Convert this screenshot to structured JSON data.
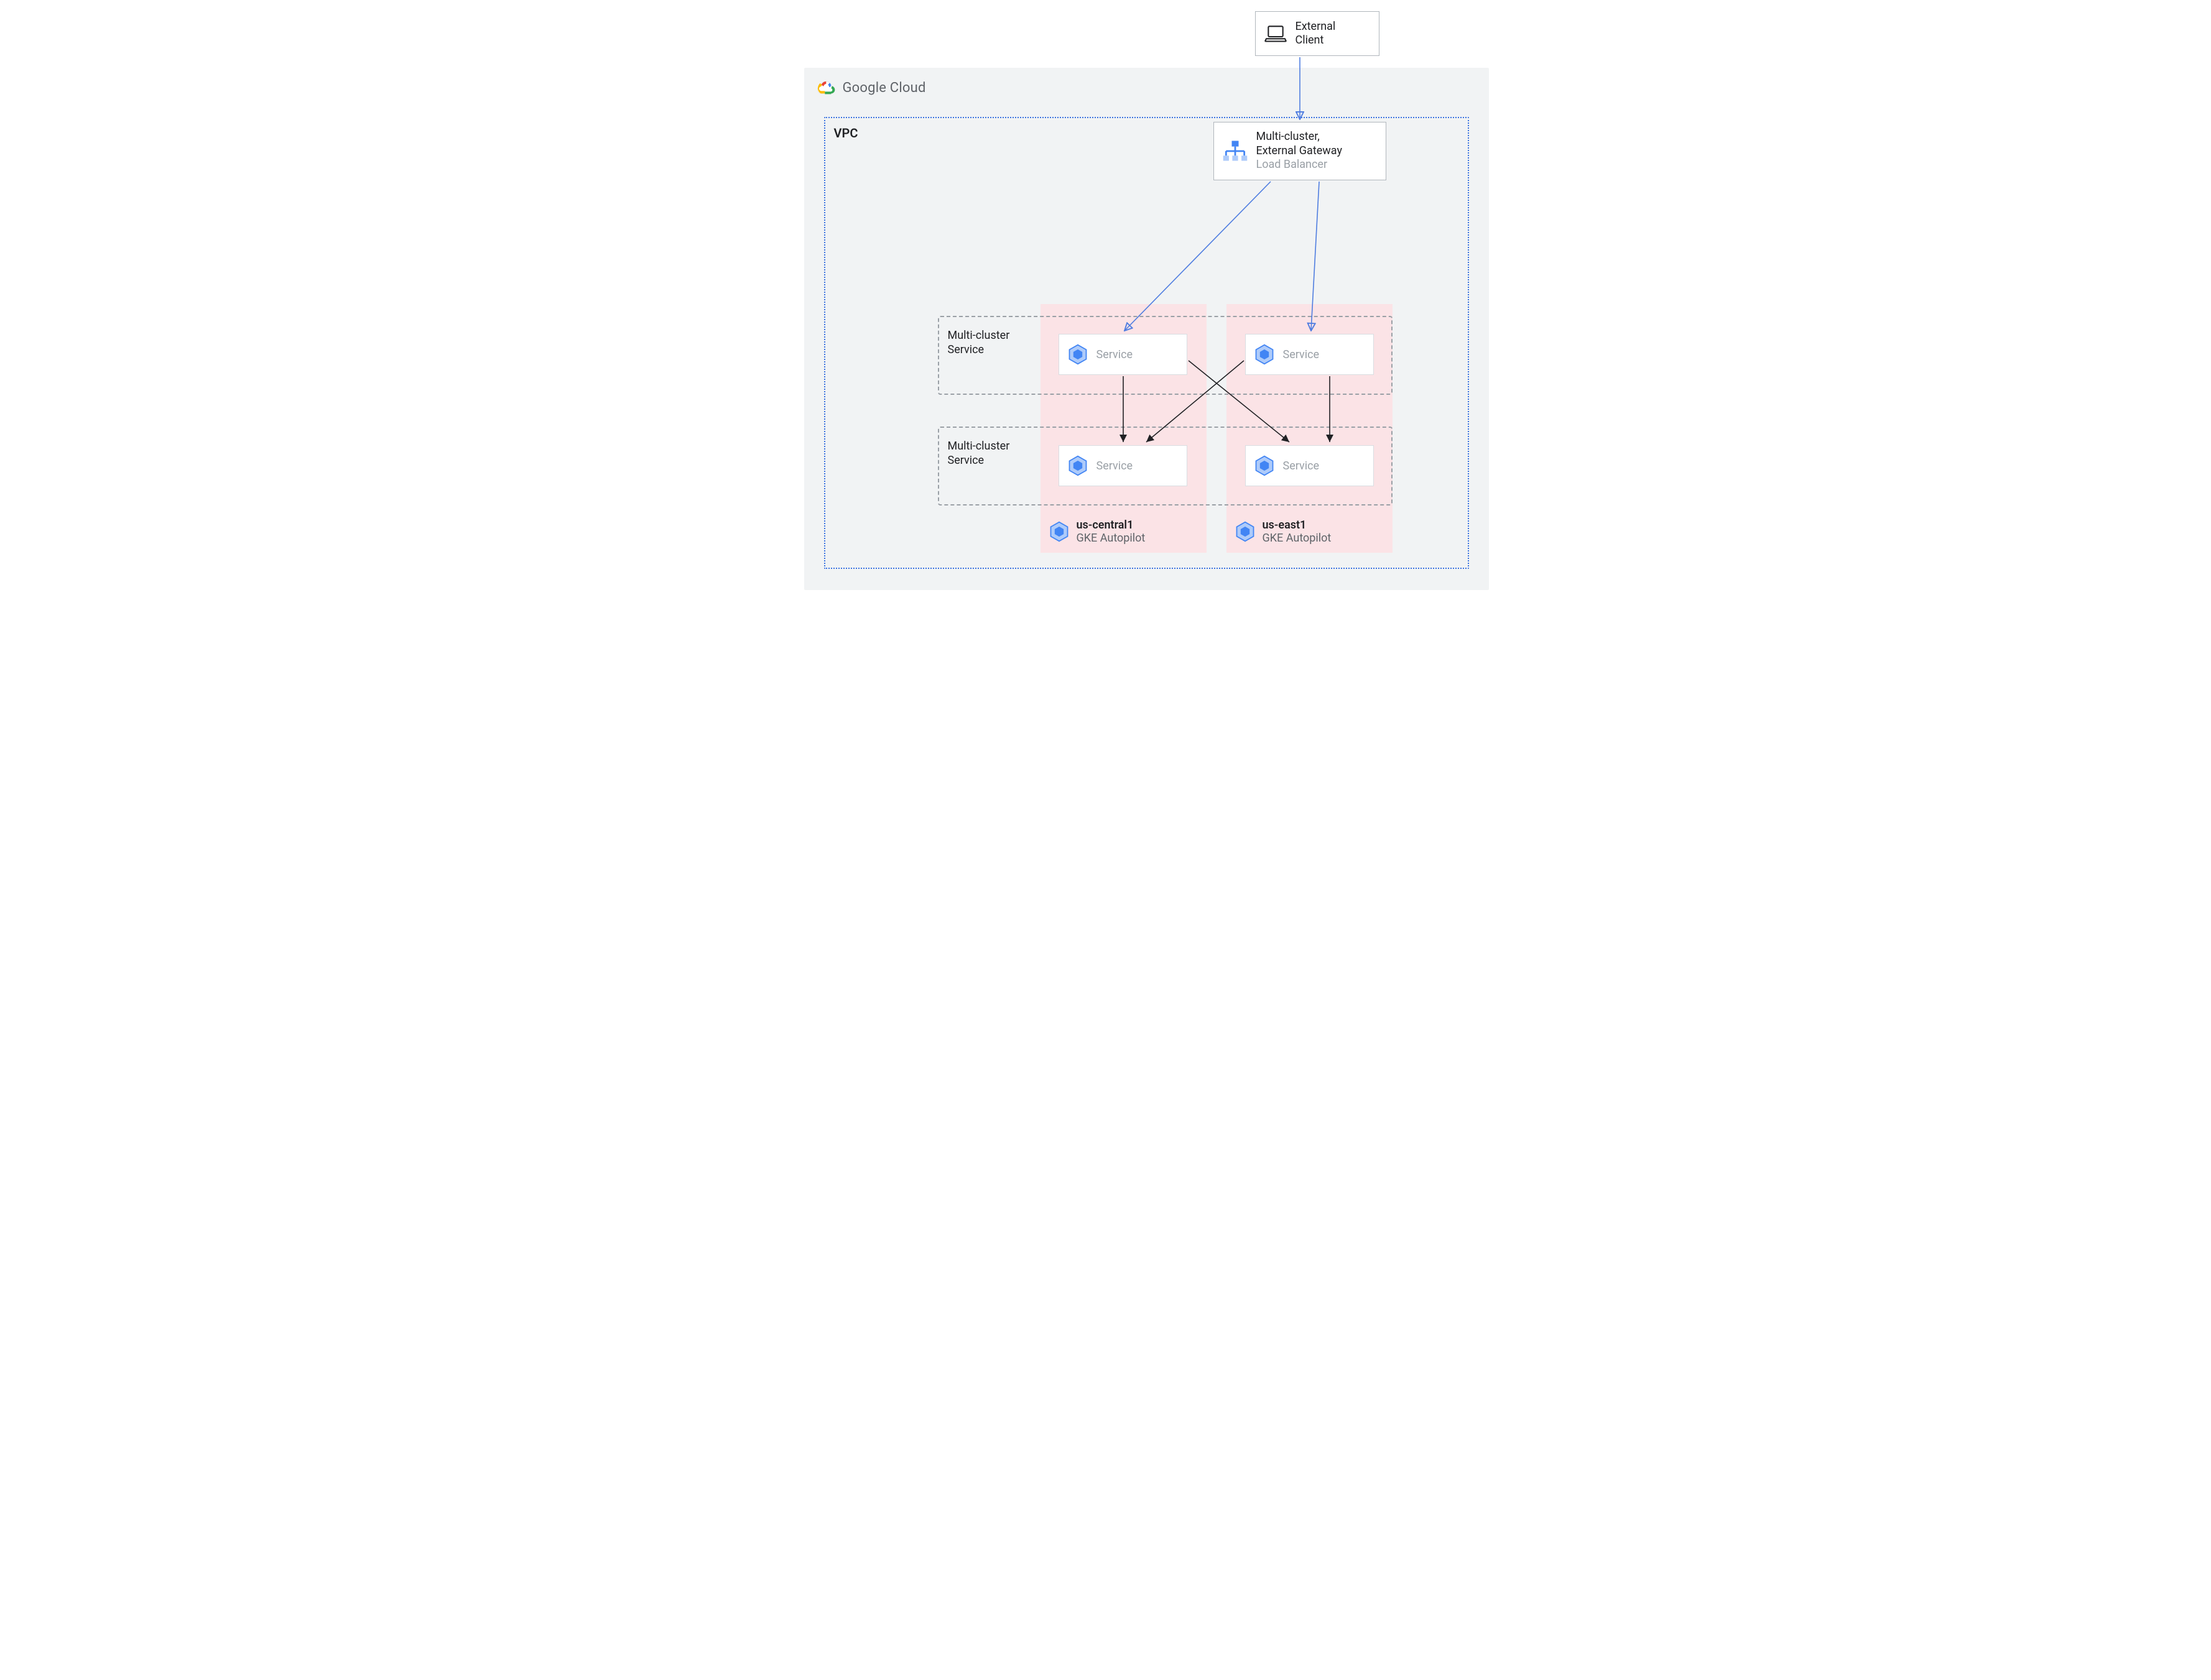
{
  "external_client": {
    "line1": "External",
    "line2": "Client"
  },
  "cloud": {
    "brand": "Google Cloud"
  },
  "vpc": {
    "label": "VPC"
  },
  "gateway": {
    "line1": "Multi-cluster,",
    "line2": "External Gateway",
    "subtitle": "Load Balancer"
  },
  "mcs": {
    "label_line1": "Multi-cluster",
    "label_line2": "Service",
    "service_label": "Service"
  },
  "clusters": {
    "a": {
      "name": "us-central1",
      "sub": "GKE Autopilot"
    },
    "b": {
      "name": "us-east1",
      "sub": "GKE Autopilot"
    }
  },
  "colors": {
    "blue": "#4f7de0",
    "black": "#202124",
    "gray": "#9aa0a6",
    "pink": "#fbe3e6",
    "panel": "#f1f3f4"
  }
}
